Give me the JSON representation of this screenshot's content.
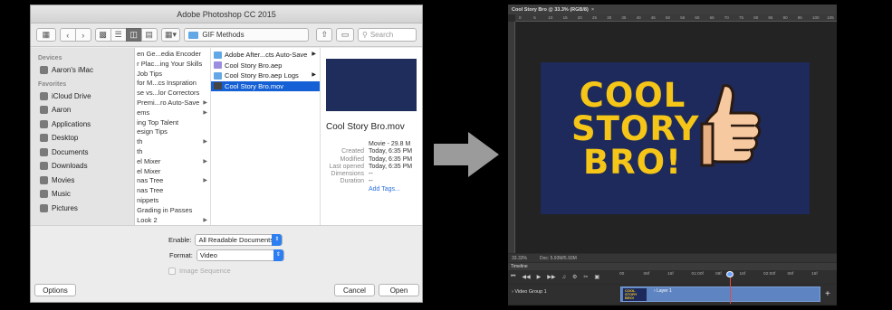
{
  "dialog": {
    "title": "Adobe Photoshop CC 2015",
    "path_folder": "GIF Methods",
    "search_placeholder": "Search",
    "sidebar": {
      "devices_header": "Devices",
      "devices": [
        {
          "label": "Aaron's iMac",
          "icon": "imac-icon"
        }
      ],
      "favorites_header": "Favorites",
      "favorites": [
        {
          "label": "iCloud Drive",
          "icon": "cloud-icon"
        },
        {
          "label": "Aaron",
          "icon": "home-icon"
        },
        {
          "label": "Applications",
          "icon": "applications-icon"
        },
        {
          "label": "Desktop",
          "icon": "desktop-icon"
        },
        {
          "label": "Documents",
          "icon": "documents-icon"
        },
        {
          "label": "Downloads",
          "icon": "downloads-icon"
        },
        {
          "label": "Movies",
          "icon": "movies-icon"
        },
        {
          "label": "Music",
          "icon": "music-icon"
        },
        {
          "label": "Pictures",
          "icon": "pictures-icon"
        }
      ]
    },
    "column1": [
      {
        "label": "en Ge...edia Encoder",
        "arrow": false
      },
      {
        "label": "r Plac...ing Your Skills",
        "arrow": false
      },
      {
        "label": "Job Tips",
        "arrow": false
      },
      {
        "label": "for M...cs Inspration",
        "arrow": false
      },
      {
        "label": "se vs...lor Correctors",
        "arrow": false
      },
      {
        "label": "Premi...ro Auto-Save",
        "arrow": true
      },
      {
        "label": "ems",
        "arrow": true
      },
      {
        "label": "ing Top Talent",
        "arrow": false
      },
      {
        "label": "esign Tips",
        "arrow": false
      },
      {
        "label": "th",
        "arrow": true
      },
      {
        "label": "th",
        "arrow": false
      },
      {
        "label": "el Mixer",
        "arrow": true
      },
      {
        "label": "el Mixer",
        "arrow": false
      },
      {
        "label": "nas Tree",
        "arrow": true
      },
      {
        "label": "nas Tree",
        "arrow": false
      },
      {
        "label": "nippets",
        "arrow": false
      },
      {
        "label": "Grading in Passes",
        "arrow": false
      },
      {
        "label": "Look 2",
        "arrow": true
      }
    ],
    "column2": [
      {
        "label": "Adobe After...cts Auto-Save",
        "icon": "folder-icon",
        "arrow": true,
        "selected": false
      },
      {
        "label": "Cool Story Bro.aep",
        "icon": "aep-file-icon",
        "arrow": false,
        "selected": false
      },
      {
        "label": "Cool Story Bro.aep Logs",
        "icon": "folder-icon",
        "arrow": true,
        "selected": false
      },
      {
        "label": "Cool Story Bro.mov",
        "icon": "mov-file-icon",
        "arrow": false,
        "selected": true
      }
    ],
    "preview": {
      "name": "Cool Story Bro.mov",
      "meta": [
        {
          "key": "",
          "value": "Movie - 29.8 M"
        },
        {
          "key": "Created",
          "value": "Today, 6:35 PM"
        },
        {
          "key": "Modified",
          "value": "Today, 6:35 PM"
        },
        {
          "key": "Last opened",
          "value": "Today, 6:35 PM"
        },
        {
          "key": "Dimensions",
          "value": "--"
        },
        {
          "key": "Duration",
          "value": "--"
        }
      ],
      "add_tags": "Add Tags..."
    },
    "enable_label": "Enable:",
    "enable_value": "All Readable Documents",
    "format_label": "Format:",
    "format_value": "Video",
    "image_sequence_label": "Image Sequence",
    "options_button": "Options",
    "cancel_button": "Cancel",
    "open_button": "Open"
  },
  "photoshop": {
    "tab_title": "Cool Story Bro @ 33.3% (RGB/8)",
    "ruler_ticks": [
      "0",
      "5",
      "10",
      "15",
      "20",
      "25",
      "30",
      "35",
      "40",
      "45",
      "50",
      "55",
      "60",
      "65",
      "70",
      "75",
      "80",
      "85",
      "90",
      "95",
      "100",
      "105"
    ],
    "artwork_lines": [
      "COOL",
      "STORY",
      "BRO!"
    ],
    "zoom": "33.33%",
    "doc_info": "Doc: 5.93M/5.93M",
    "timeline_label": "Timeline",
    "timeline_ticks": [
      "00",
      "08f",
      "16f",
      "01:00f",
      "08f",
      "16f",
      "02:00f",
      "08f",
      "16f"
    ],
    "video_group": "Video Group 1",
    "layer": "Layer 1",
    "colors": {
      "artboard": "#1d2a5b",
      "text": "#f5c518",
      "clip": "#5e85c1",
      "playhead": "#e04a4a"
    }
  }
}
